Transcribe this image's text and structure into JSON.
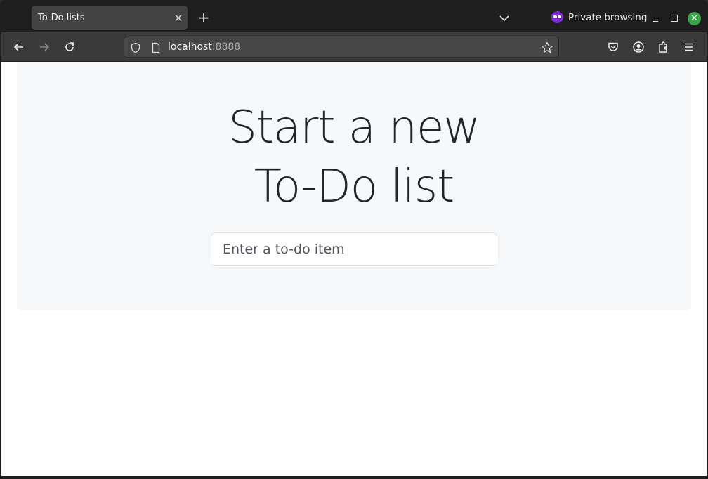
{
  "browser": {
    "tab": {
      "title": "To-Do lists",
      "close_icon": "close-icon"
    },
    "new_tab_icon": "plus-icon",
    "tab_list_icon": "chevron-down-icon",
    "private_label": "Private browsing",
    "window_controls": [
      "minimize",
      "maximize",
      "close"
    ],
    "url": {
      "host": "localhost",
      "port": ":8888"
    },
    "colors": {
      "private_accent": "#7c2ad4",
      "close_button": "#3aa54a"
    }
  },
  "page": {
    "heading_line1": "Start a new",
    "heading_line2": "To-Do list",
    "input": {
      "placeholder": "Enter a to-do item",
      "value": ""
    }
  }
}
